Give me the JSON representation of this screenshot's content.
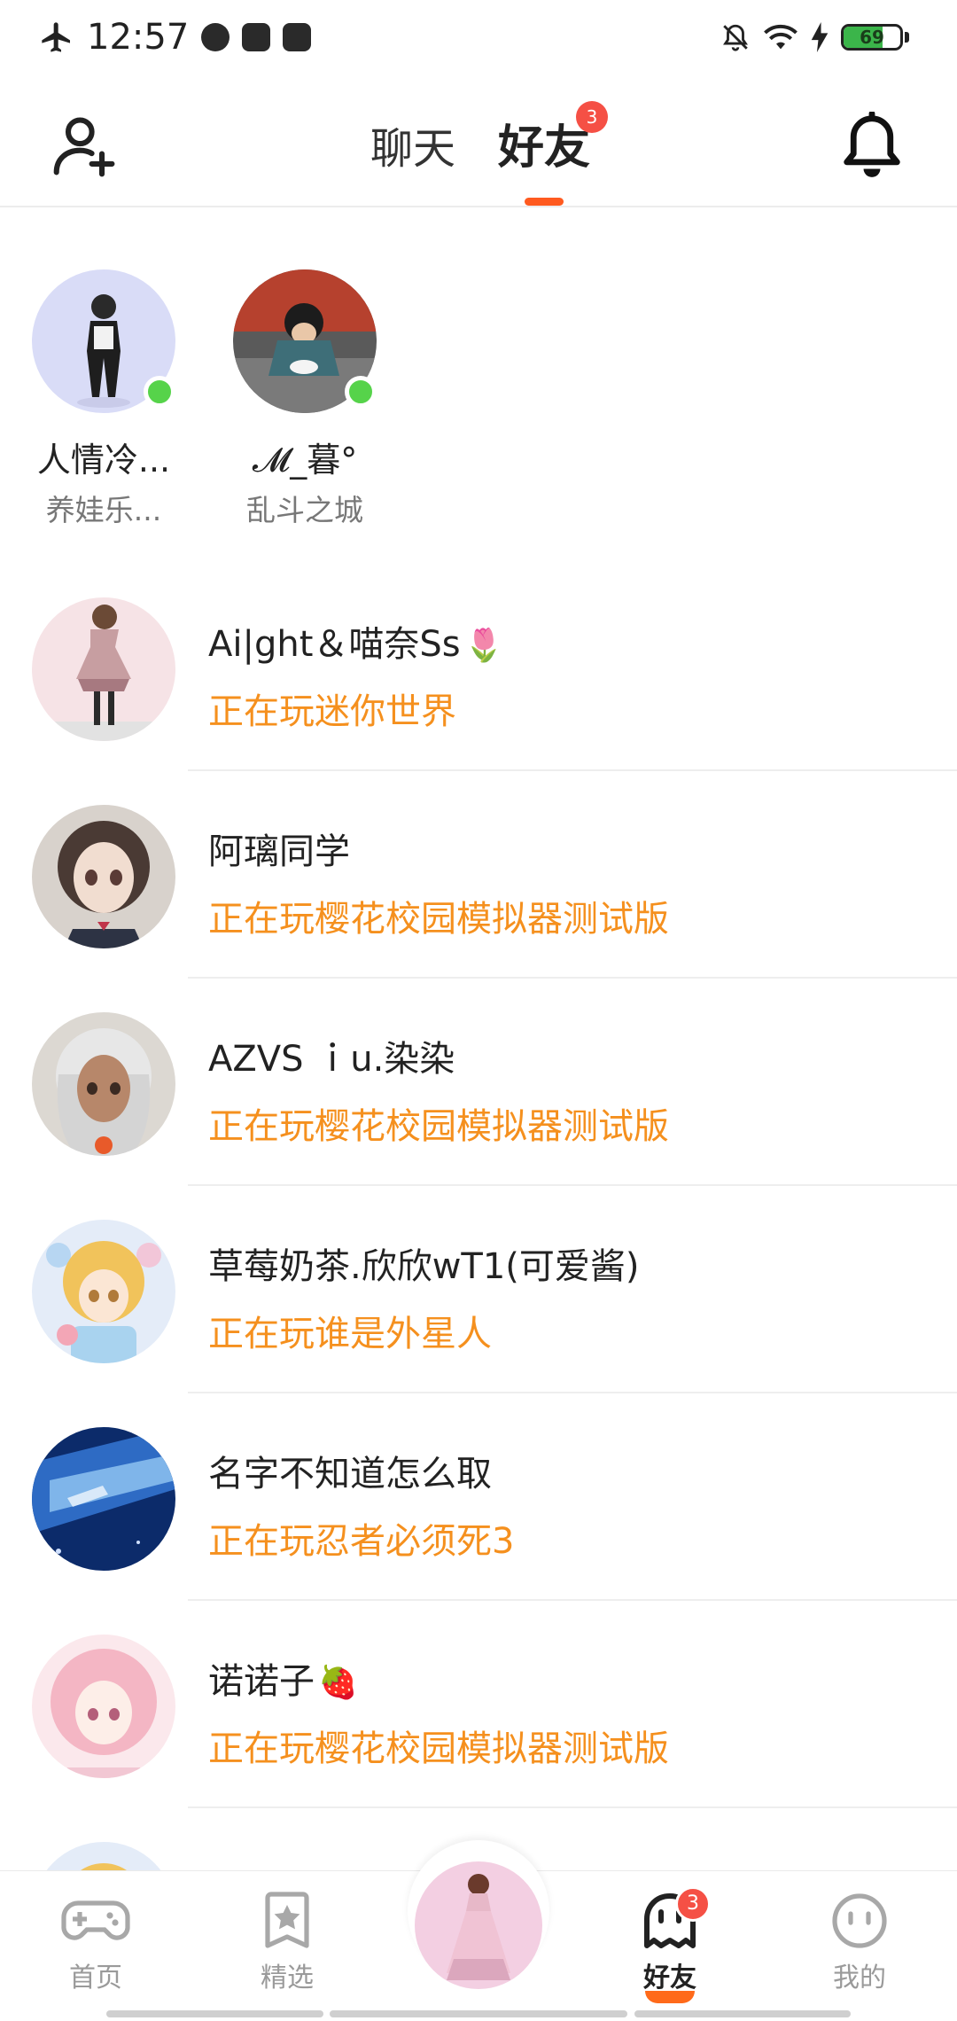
{
  "status_bar": {
    "time": "12:57",
    "battery": "69",
    "battery_level": 0.69,
    "left_icons": [
      "airplane-icon",
      "app-icon",
      "mail-icon",
      "music-app-icon"
    ],
    "right_icons": [
      "mute-icon",
      "wifi-icon",
      "charging-icon",
      "battery-icon"
    ]
  },
  "header": {
    "tabs": [
      {
        "label": "聊天",
        "active": false
      },
      {
        "label": "好友",
        "active": true,
        "badge": "3"
      }
    ],
    "left_icon": "add-friend-icon",
    "right_icon": "bell-icon",
    "accent_color": "#ff5a1f"
  },
  "online_friends": [
    {
      "name": "人情冷...",
      "game": "养娃乐...",
      "online": true
    },
    {
      "name": "𝓜_暮°",
      "game": "乱斗之城",
      "online": true
    }
  ],
  "friends": [
    {
      "name": "Ai|ght＆喵奈Ss",
      "emoji": "🌷",
      "status": "正在玩迷你世界"
    },
    {
      "name": "阿璃同学",
      "emoji": "",
      "status": "正在玩樱花校园模拟器测试版"
    },
    {
      "name": "AZVS ｉu.染染",
      "emoji": "",
      "status": "正在玩樱花校园模拟器测试版"
    },
    {
      "name": "草莓奶茶.欣欣wT1(可爱酱)",
      "emoji": "",
      "status": "正在玩谁是外星人"
    },
    {
      "name": "名字不知道怎么取",
      "emoji": "",
      "status": "正在玩忍者必须死3"
    },
    {
      "name": "诺诺子",
      "emoji": "🍓",
      "status": "正在玩樱花校园模拟器测试版"
    }
  ],
  "status_color": "#f5901e",
  "bottom_nav": {
    "items": [
      {
        "label": "首页",
        "icon": "gamepad-icon",
        "active": false
      },
      {
        "label": "精选",
        "icon": "star-bookmark-icon",
        "active": false
      },
      {
        "label": "好友",
        "icon": "ghost-icon",
        "active": true,
        "badge": "3"
      },
      {
        "label": "我的",
        "icon": "smiley-face-icon",
        "active": false
      }
    ],
    "center_icon": "profile-avatar"
  }
}
